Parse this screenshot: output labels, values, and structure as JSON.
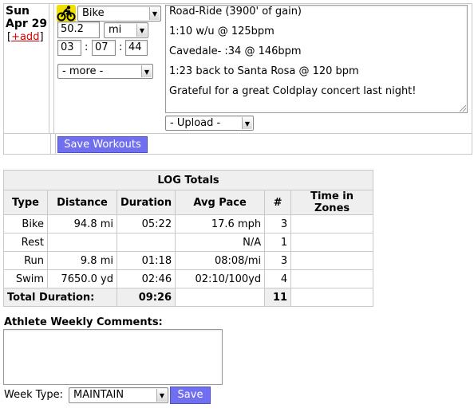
{
  "entry": {
    "day_of_week": "Sun",
    "month_day": "Apr 29",
    "add_bracket_open": "[",
    "add_link": "+add",
    "add_bracket_close": "]",
    "sport_icon": "cyclist-icon",
    "sport": "Bike",
    "distance": "50.2",
    "distance_unit": "mi",
    "time_h": "03",
    "time_m": "07",
    "time_s": "44",
    "colon": ":",
    "more": "- more -",
    "upload": "- Upload -",
    "notes": [
      "Road-Ride (3900' of gain)",
      "1:10 w/u @ 125bpm",
      "Cavedale- :34 @ 146bpm",
      "1:23 back to Santa Rosa @ 120 bpm",
      "Grateful for a great Coldplay concert last night!"
    ],
    "save_button": "Save Workouts"
  },
  "totals": {
    "title": "LOG Totals",
    "headers": [
      "Type",
      "Distance",
      "Duration",
      "Avg Pace",
      "#",
      "Time in Zones"
    ],
    "rows": [
      {
        "type": "Bike",
        "distance": "94.8 mi",
        "duration": "05:22",
        "pace": "17.6 mph",
        "count": "3",
        "zones": ""
      },
      {
        "type": "Rest",
        "distance": "",
        "duration": "",
        "pace": "N/A",
        "count": "1",
        "zones": ""
      },
      {
        "type": "Run",
        "distance": "9.8 mi",
        "duration": "01:18",
        "pace": "08:08/mi",
        "count": "3",
        "zones": ""
      },
      {
        "type": "Swim",
        "distance": "7650.0 yd",
        "duration": "02:46",
        "pace": "02:10/100yd",
        "count": "4",
        "zones": ""
      }
    ],
    "total_label": "Total Duration:",
    "total_duration": "09:26",
    "total_count": "11"
  },
  "comments": {
    "label": "Athlete Weekly Comments:",
    "value": ""
  },
  "week": {
    "label": "Week Type:",
    "value": "MAINTAIN",
    "save": "Save"
  },
  "colors": {
    "button": "#6f6ff0",
    "add_link": "#d40000",
    "header_bg": "#efefef",
    "sport_icon_bg": "#f0e000"
  }
}
